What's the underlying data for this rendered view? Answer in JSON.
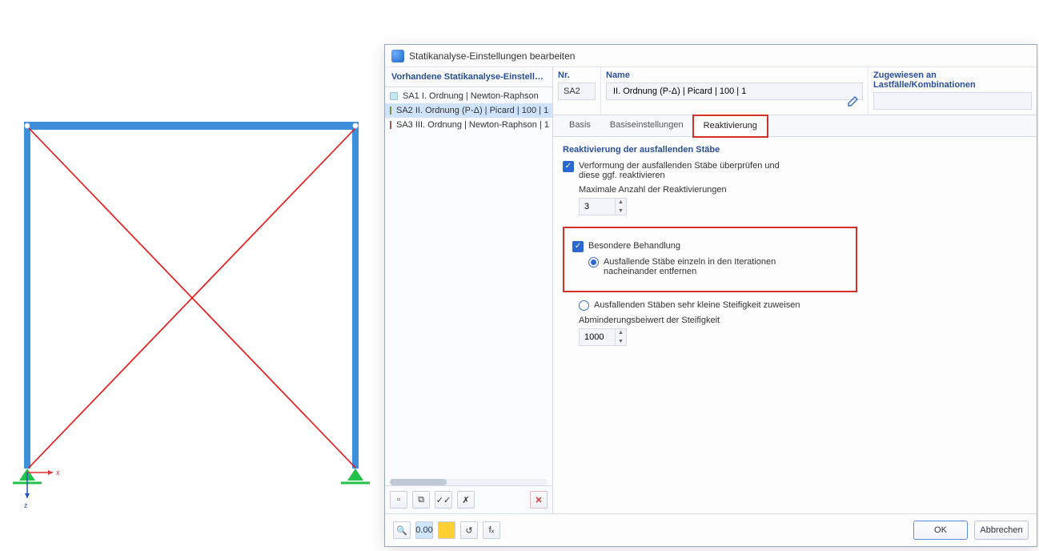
{
  "viewport": {
    "axis_x": "x",
    "axis_z": "z"
  },
  "dialog": {
    "title": "Statikanalyse-Einstellungen bearbeiten",
    "list_header": "Vorhandene Statikanalyse-Einstellungen",
    "items": [
      {
        "code": "SA1",
        "label": "I. Ordnung | Newton-Raphson",
        "color": "#bfe7f4",
        "selected": false
      },
      {
        "code": "SA2",
        "label": "II. Ordnung (P-Δ) | Picard | 100 | 1",
        "color": "#9aa748",
        "selected": true
      },
      {
        "code": "SA3",
        "label": "III. Ordnung | Newton-Raphson | 1",
        "color": "#b06a5e",
        "selected": false
      }
    ],
    "header": {
      "nr_label": "Nr.",
      "name_label": "Name",
      "assign_label": "Zugewiesen an Lastfälle/Kombinationen",
      "nr_value": "SA2",
      "name_value": "II. Ordnung (P-Δ) | Picard | 100 | 1"
    },
    "tabs": [
      {
        "label": "Basis",
        "active": false
      },
      {
        "label": "Basiseinstellungen",
        "active": false
      },
      {
        "label": "Reaktivierung",
        "active": true
      }
    ],
    "section_title": "Reaktivierung der ausfallenden Stäbe",
    "check_verify": {
      "label": "Verformung der ausfallenden Stäbe überprüfen und diese ggf. reaktivieren",
      "max_label": "Maximale Anzahl der Reaktivierungen",
      "max_value": "3"
    },
    "check_special": {
      "label": "Besondere Behandlung",
      "radio_remove": "Ausfallende Stäbe einzeln in den Iterationen nacheinander entfernen",
      "radio_stiff": "Ausfallenden Stäben sehr kleine Steifigkeit zuweisen",
      "stiff_label": "Abminderungsbeiwert der Steifigkeit",
      "stiff_value": "1000"
    },
    "buttons": {
      "ok": "OK",
      "cancel": "Abbrechen"
    }
  }
}
